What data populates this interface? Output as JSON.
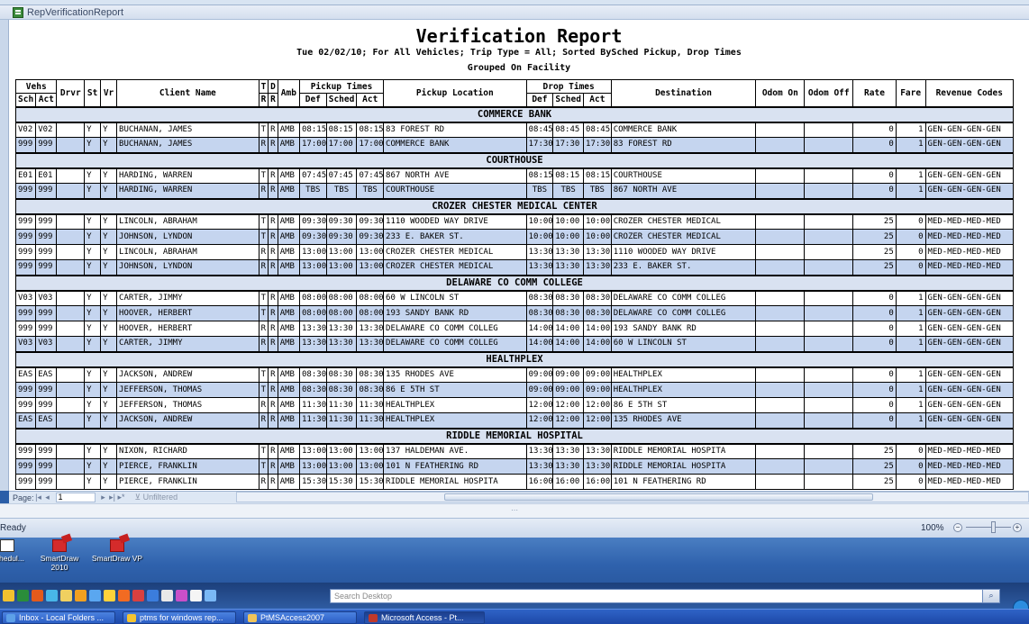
{
  "window": {
    "title": "RepVerificationReport"
  },
  "report": {
    "title": "Verification Report",
    "subtitle": "Tue 02/02/10; For All Vehicles; Trip Type = All; Sorted BySched Pickup, Drop Times",
    "grouping": "Grouped On Facility",
    "headers": {
      "vehs": "Vehs",
      "sch": "Sch",
      "act": "Act",
      "drvr": "Drvr",
      "st": "St",
      "vr": "Vr",
      "client": "Client Name",
      "t": "T",
      "r1": "R",
      "d": "D",
      "r2": "R",
      "amb": "Amb",
      "pickup_times": "Pickup Times",
      "def": "Def",
      "sched": "Sched",
      "act2": "Act",
      "pickup_location": "Pickup Location",
      "drop_times": "Drop Times",
      "def2": "Def",
      "sched2": "Sched",
      "act3": "Act",
      "destination": "Destination",
      "odom_on": "Odom On",
      "odom_off": "Odom Off",
      "rate": "Rate",
      "fare": "Fare",
      "revenue_codes": "Revenue Codes"
    },
    "groups": [
      {
        "name": "COMMERCE BANK",
        "rows": [
          [
            "V02",
            "V02",
            "",
            "Y",
            "Y",
            "BUCHANAN, JAMES",
            "T",
            "R",
            "AMB",
            "08:15",
            "08:15",
            "08:15",
            "83 FOREST RD",
            "08:45",
            "08:45",
            "08:45",
            "COMMERCE BANK",
            "",
            "",
            "0",
            "1",
            "GEN-GEN-GEN-GEN"
          ],
          [
            "999",
            "999",
            "",
            "Y",
            "Y",
            "BUCHANAN, JAMES",
            "R",
            "R",
            "AMB",
            "17:00",
            "17:00",
            "17:00",
            "COMMERCE BANK",
            "17:30",
            "17:30",
            "17:30",
            "83 FOREST RD",
            "",
            "",
            "0",
            "1",
            "GEN-GEN-GEN-GEN"
          ]
        ]
      },
      {
        "name": "COURTHOUSE",
        "rows": [
          [
            "E01",
            "E01",
            "",
            "Y",
            "Y",
            "HARDING, WARREN",
            "T",
            "R",
            "AMB",
            "07:45",
            "07:45",
            "07:45",
            "867 NORTH AVE",
            "08:15",
            "08:15",
            "08:15",
            "COURTHOUSE",
            "",
            "",
            "0",
            "1",
            "GEN-GEN-GEN-GEN"
          ],
          [
            "999",
            "999",
            "",
            "Y",
            "Y",
            "HARDING, WARREN",
            "R",
            "R",
            "AMB",
            "TBS",
            "TBS",
            "TBS",
            "COURTHOUSE",
            "TBS",
            "TBS",
            "TBS",
            "867 NORTH AVE",
            "",
            "",
            "0",
            "1",
            "GEN-GEN-GEN-GEN"
          ]
        ]
      },
      {
        "name": "CROZER CHESTER MEDICAL CENTER",
        "rows": [
          [
            "999",
            "999",
            "",
            "Y",
            "Y",
            "LINCOLN, ABRAHAM",
            "T",
            "R",
            "AMB",
            "09:30",
            "09:30",
            "09:30",
            "1110 WOODED WAY DRIVE",
            "10:00",
            "10:00",
            "10:00",
            "CROZER CHESTER MEDICAL",
            "",
            "",
            "25",
            "0",
            "MED-MED-MED-MED"
          ],
          [
            "999",
            "999",
            "",
            "Y",
            "Y",
            "JOHNSON, LYNDON",
            "T",
            "R",
            "AMB",
            "09:30",
            "09:30",
            "09:30",
            "233 E. BAKER ST.",
            "10:00",
            "10:00",
            "10:00",
            "CROZER CHESTER MEDICAL",
            "",
            "",
            "25",
            "0",
            "MED-MED-MED-MED"
          ],
          [
            "999",
            "999",
            "",
            "Y",
            "Y",
            "LINCOLN, ABRAHAM",
            "R",
            "R",
            "AMB",
            "13:00",
            "13:00",
            "13:00",
            "CROZER CHESTER MEDICAL",
            "13:30",
            "13:30",
            "13:30",
            "1110 WOODED WAY DRIVE",
            "",
            "",
            "25",
            "0",
            "MED-MED-MED-MED"
          ],
          [
            "999",
            "999",
            "",
            "Y",
            "Y",
            "JOHNSON, LYNDON",
            "R",
            "R",
            "AMB",
            "13:00",
            "13:00",
            "13:00",
            "CROZER CHESTER MEDICAL",
            "13:30",
            "13:30",
            "13:30",
            "233 E. BAKER ST.",
            "",
            "",
            "25",
            "0",
            "MED-MED-MED-MED"
          ]
        ]
      },
      {
        "name": "DELAWARE CO COMM COLLEGE",
        "rows": [
          [
            "V03",
            "V03",
            "",
            "Y",
            "Y",
            "CARTER, JIMMY",
            "T",
            "R",
            "AMB",
            "08:00",
            "08:00",
            "08:00",
            "60 W LINCOLN ST",
            "08:30",
            "08:30",
            "08:30",
            "DELAWARE CO COMM COLLEG",
            "",
            "",
            "0",
            "1",
            "GEN-GEN-GEN-GEN"
          ],
          [
            "999",
            "999",
            "",
            "Y",
            "Y",
            "HOOVER, HERBERT",
            "T",
            "R",
            "AMB",
            "08:00",
            "08:00",
            "08:00",
            "193 SANDY BANK RD",
            "08:30",
            "08:30",
            "08:30",
            "DELAWARE CO COMM COLLEG",
            "",
            "",
            "0",
            "1",
            "GEN-GEN-GEN-GEN"
          ],
          [
            "999",
            "999",
            "",
            "Y",
            "Y",
            "HOOVER, HERBERT",
            "R",
            "R",
            "AMB",
            "13:30",
            "13:30",
            "13:30",
            "DELAWARE CO COMM COLLEG",
            "14:00",
            "14:00",
            "14:00",
            "193 SANDY BANK RD",
            "",
            "",
            "0",
            "1",
            "GEN-GEN-GEN-GEN"
          ],
          [
            "V03",
            "V03",
            "",
            "Y",
            "Y",
            "CARTER, JIMMY",
            "R",
            "R",
            "AMB",
            "13:30",
            "13:30",
            "13:30",
            "DELAWARE CO COMM COLLEG",
            "14:00",
            "14:00",
            "14:00",
            "60 W LINCOLN ST",
            "",
            "",
            "0",
            "1",
            "GEN-GEN-GEN-GEN"
          ]
        ]
      },
      {
        "name": "HEALTHPLEX",
        "rows": [
          [
            "EAS",
            "EAS",
            "",
            "Y",
            "Y",
            "JACKSON, ANDREW",
            "T",
            "R",
            "AMB",
            "08:30",
            "08:30",
            "08:30",
            "135 RHODES AVE",
            "09:00",
            "09:00",
            "09:00",
            "HEALTHPLEX",
            "",
            "",
            "0",
            "1",
            "GEN-GEN-GEN-GEN"
          ],
          [
            "999",
            "999",
            "",
            "Y",
            "Y",
            "JEFFERSON, THOMAS",
            "T",
            "R",
            "AMB",
            "08:30",
            "08:30",
            "08:30",
            "86 E 5TH ST",
            "09:00",
            "09:00",
            "09:00",
            "HEALTHPLEX",
            "",
            "",
            "0",
            "1",
            "GEN-GEN-GEN-GEN"
          ],
          [
            "999",
            "999",
            "",
            "Y",
            "Y",
            "JEFFERSON, THOMAS",
            "R",
            "R",
            "AMB",
            "11:30",
            "11:30",
            "11:30",
            "HEALTHPLEX",
            "12:00",
            "12:00",
            "12:00",
            "86 E 5TH ST",
            "",
            "",
            "0",
            "1",
            "GEN-GEN-GEN-GEN"
          ],
          [
            "EAS",
            "EAS",
            "",
            "Y",
            "Y",
            "JACKSON, ANDREW",
            "R",
            "R",
            "AMB",
            "11:30",
            "11:30",
            "11:30",
            "HEALTHPLEX",
            "12:00",
            "12:00",
            "12:00",
            "135 RHODES AVE",
            "",
            "",
            "0",
            "1",
            "GEN-GEN-GEN-GEN"
          ]
        ]
      },
      {
        "name": "RIDDLE MEMORIAL HOSPITAL",
        "rows": [
          [
            "999",
            "999",
            "",
            "Y",
            "Y",
            "NIXON, RICHARD",
            "T",
            "R",
            "AMB",
            "13:00",
            "13:00",
            "13:00",
            "137 HALDEMAN AVE.",
            "13:30",
            "13:30",
            "13:30",
            "RIDDLE MEMORIAL HOSPITA",
            "",
            "",
            "25",
            "0",
            "MED-MED-MED-MED"
          ],
          [
            "999",
            "999",
            "",
            "Y",
            "Y",
            "PIERCE, FRANKLIN",
            "T",
            "R",
            "AMB",
            "13:00",
            "13:00",
            "13:00",
            "101 N FEATHERING RD",
            "13:30",
            "13:30",
            "13:30",
            "RIDDLE MEMORIAL HOSPITA",
            "",
            "",
            "25",
            "0",
            "MED-MED-MED-MED"
          ],
          [
            "999",
            "999",
            "",
            "Y",
            "Y",
            "PIERCE, FRANKLIN",
            "R",
            "R",
            "AMB",
            "15:30",
            "15:30",
            "15:30",
            "RIDDLE MEMORIAL HOSPITA",
            "16:00",
            "16:00",
            "16:00",
            "101 N FEATHERING RD",
            "",
            "",
            "25",
            "0",
            "MED-MED-MED-MED"
          ]
        ]
      }
    ]
  },
  "navigation": {
    "page_label": "Page:",
    "page_value": "1",
    "filter_label": "Unfiltered"
  },
  "statusbar": {
    "status": "Ready",
    "zoom": "100%"
  },
  "desktop": {
    "icons": [
      {
        "label": "Schedul..."
      },
      {
        "label": "SmartDraw 2010"
      },
      {
        "label": "SmartDraw VP"
      }
    ],
    "search_placeholder": "Search Desktop"
  },
  "taskbar": {
    "items": [
      {
        "label": "Inbox - Local Folders ...",
        "active": false
      },
      {
        "label": "ptms for windows rep...",
        "active": false
      },
      {
        "label": "PtMSAccess2007",
        "active": false
      },
      {
        "label": "Microsoft Access - Pt...",
        "active": true
      }
    ]
  }
}
